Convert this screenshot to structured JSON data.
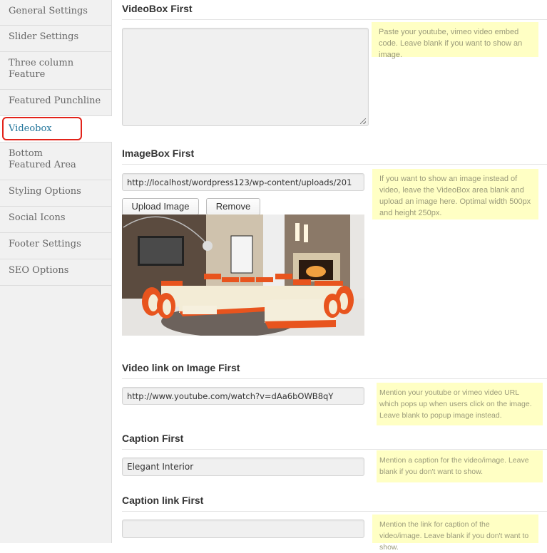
{
  "sidebar": {
    "items": [
      {
        "label": "General Settings",
        "active": false
      },
      {
        "label": "Slider Settings",
        "active": false
      },
      {
        "label": "Three column Feature",
        "active": false
      },
      {
        "label": "Featured Punchline",
        "active": false
      },
      {
        "label": "Videobox",
        "active": true
      },
      {
        "label": "Bottom Featured Area",
        "active": false
      },
      {
        "label": "Styling Options",
        "active": false
      },
      {
        "label": "Social Icons",
        "active": false
      },
      {
        "label": "Footer Settings",
        "active": false
      },
      {
        "label": "SEO Options",
        "active": false
      }
    ]
  },
  "main": {
    "videobox": {
      "title": "VideoBox First",
      "value": "",
      "help": "Paste your youtube, vimeo video embed code. Leave blank if you want to show an image."
    },
    "imagebox": {
      "title": "ImageBox First",
      "value": "http://localhost/wordpress123/wp-content/uploads/201",
      "upload_label": "Upload Image",
      "remove_label": "Remove",
      "preview_alt": "Living room interior with orange and cream sectional sofa",
      "help": "If you want to show an image instead of video, leave the VideoBox area blank and upload an image here. Optimal width 500px and height 250px."
    },
    "video_link": {
      "title": "Video link on Image First",
      "value": "http://www.youtube.com/watch?v=dAa6bOWB8qY",
      "help": "Mention your youtube or vimeo video URL which pops up when users click on the image. Leave blank to popup image instead."
    },
    "caption": {
      "title": "Caption First",
      "value": "Elegant Interior",
      "help": "Mention a caption for the video/image. Leave blank if you don't want to show."
    },
    "caption_link": {
      "title": "Caption link First",
      "value": "",
      "help": "Mention the link for caption of the video/image. Leave blank if you don't want to show."
    }
  },
  "colors": {
    "active_link": "#21759b",
    "highlight_border": "#e2231a",
    "help_background": "#ffffc4"
  }
}
